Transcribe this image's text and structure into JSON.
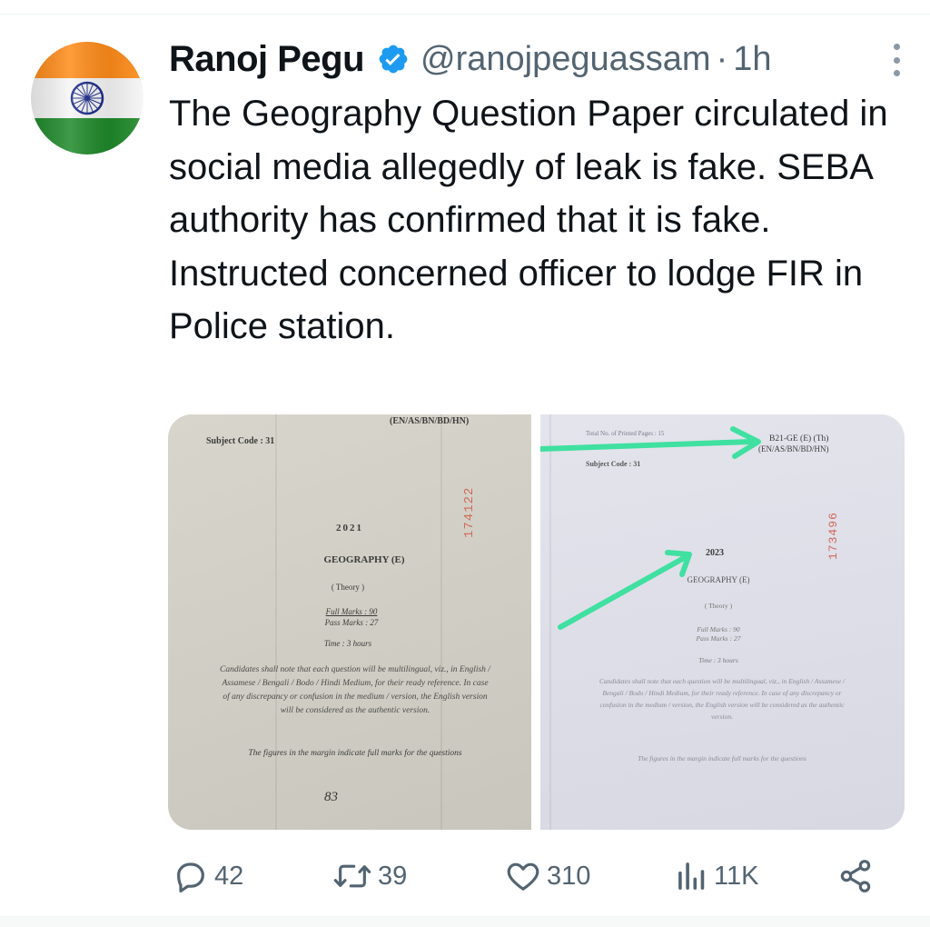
{
  "tweet": {
    "author_name": "Ranoj Pegu",
    "handle": "@ranojpeguassam",
    "separator": "·",
    "time": "1h",
    "text": "The Geography Question Paper circulated in social media allegedly of leak is fake. SEBA authority has confirmed that it is fake. Instructed concerned officer to lodge FIR in Police station."
  },
  "media": {
    "left": {
      "subject_code": "Subject Code : 31",
      "medium": "(EN/AS/BN/BD/HN)",
      "year": "2021",
      "title": "GEOGRAPHY (E)",
      "theory": "( Theory )",
      "full_marks": "Full Marks : 90",
      "pass_marks": "Pass Marks : 27",
      "time": "Time : 3 hours",
      "instructions": "Candidates shall note that each question will be multilingual, viz., in English / Assamese / Bengali / Bodo / Hindi Medium, for their ready reference. In case of any discrepancy or confusion in the medium / version, the English version will be considered as the authentic version.",
      "figures_note": "The figures in the margin indicate full marks for the questions",
      "serial": "174122",
      "handwritten": "83"
    },
    "right": {
      "printed_pages": "Total No. of Printed Pages : 15",
      "code": "B21-GE (E) (Th)",
      "medium": "(EN/AS/BN/BD/HN)",
      "subject_code": "Subject Code : 31",
      "year": "2023",
      "title": "GEOGRAPHY (E)",
      "theory": "( Theory )",
      "full_marks": "Full Marks : 90",
      "pass_marks": "Pass Marks : 27",
      "time": "Time : 3 hours",
      "instructions": "Candidates shall note that each question will be multilingual, viz., in English / Assamese / Bengali / Bodo / Hindi Medium, for their ready reference. In case of any discrepancy or confusion in the medium / version, the English version will be considered as the authentic version.",
      "figures_note": "The figures in the margin indicate full marks for the questions",
      "serial": "173496"
    }
  },
  "actions": {
    "replies": "42",
    "retweets": "39",
    "likes": "310",
    "views": "11K"
  },
  "colors": {
    "verified": "#1d9bf0",
    "arrow": "#3fe0a0",
    "muted": "#536471",
    "saffron": "#ff8c1a",
    "green": "#1f8a2a",
    "chakra": "#1a2a8a"
  },
  "icons": [
    "more-icon",
    "verified-icon",
    "reply-icon",
    "retweet-icon",
    "like-icon",
    "views-icon",
    "share-icon"
  ]
}
